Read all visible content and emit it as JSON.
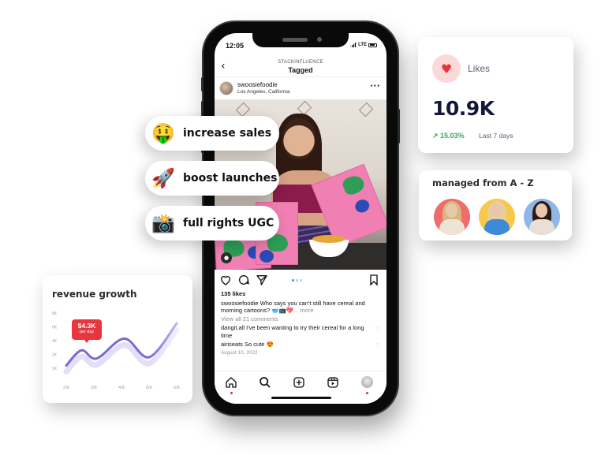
{
  "phone": {
    "status": {
      "time": "12:05",
      "network": "LTE"
    },
    "header": {
      "subtitle": "STACKINFLUENCE",
      "title": "Tagged",
      "back_icon": "chevron-left-icon"
    },
    "post": {
      "username": "swoosiefoodie",
      "location": "Los Angeles, California",
      "more_icon": "more-horizontal-icon",
      "carousel": {
        "count": 3,
        "active": 1
      },
      "likes": "135 likes",
      "caption": {
        "user": "swoosiefoodie",
        "text": "Who says you can't still have cereal and morning cartoons? 🥣📺💖",
        "more": "... more"
      },
      "view_all_comments": "View all 21 comments",
      "comments": [
        {
          "user": "dangit.all",
          "text": "I've been wanting to try their cereal for a long time"
        },
        {
          "user": "airiseats",
          "text": "So cute 😍"
        }
      ],
      "date": "August 10, 2022"
    },
    "tabbar": [
      "home-icon",
      "search-icon",
      "add-post-icon",
      "reels-icon",
      "profile-icon"
    ]
  },
  "pills": [
    {
      "emoji": "🤑",
      "label": "increase sales"
    },
    {
      "emoji": "🚀",
      "label": "boost launches"
    },
    {
      "emoji": "📸",
      "label": "full rights UGC"
    }
  ],
  "likes_card": {
    "label": "Likes",
    "value": "10.9K",
    "trend": "↗ 15.03%",
    "period": "Last 7 days",
    "colors": {
      "accent": "#e8353c",
      "trend": "#3aa758"
    }
  },
  "managed_card": {
    "title": "managed from A - Z",
    "creators": [
      {
        "bg": "#f06b6b"
      },
      {
        "bg": "#f6c84c"
      },
      {
        "bg": "#8fb6e6"
      }
    ]
  },
  "revenue_card": {
    "title": "revenue growth",
    "tooltip": {
      "value": "$4.3K",
      "label": "per day"
    }
  },
  "chart_data": {
    "type": "line",
    "title": "revenue growth",
    "x": [
      "2/8",
      "3/8",
      "4/8",
      "5/8",
      "6/8"
    ],
    "y_ticks": [
      "8K",
      "6K",
      "4K",
      "2K",
      "1K"
    ],
    "series": [
      {
        "name": "revenue",
        "values": [
          1.2,
          2.6,
          1.7,
          4.3,
          1.8,
          6.5
        ]
      }
    ],
    "x_points": [
      0,
      0.55,
      1.1,
      2.1,
      3.0,
      4.0
    ],
    "annotation": {
      "x": "4/8",
      "value": "$4.3K",
      "label": "per day"
    },
    "colors": {
      "line": "#7b68d9",
      "shadow": "#d8d0f6"
    }
  }
}
